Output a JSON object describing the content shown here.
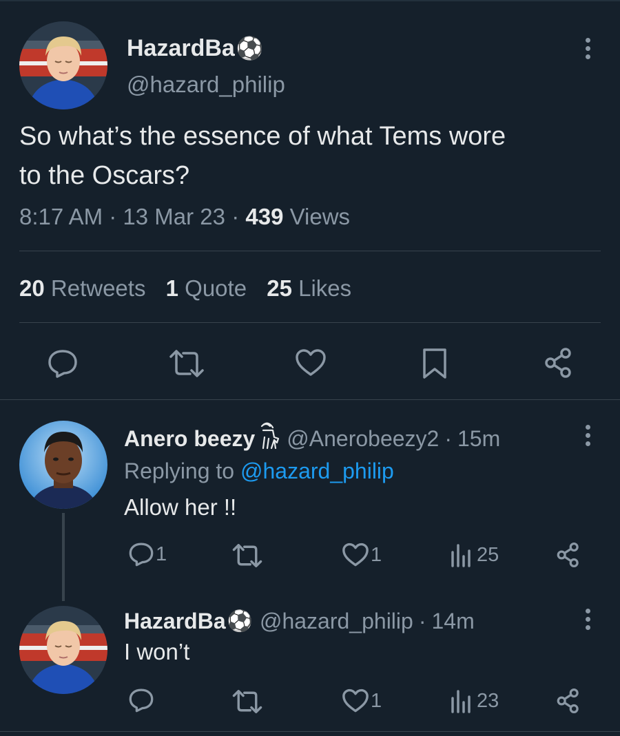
{
  "main_tweet": {
    "display_name": "HazardBa",
    "name_emoji": "⚽",
    "handle": "@hazard_philip",
    "text_line1": "So what’s the essence of what Tems wore",
    "text_line2": "to the Oscars?",
    "time": "8:17 AM",
    "date": "13 Mar 23",
    "views_count": "439",
    "views_label": "Views",
    "sep": "·",
    "retweets_count": "20",
    "retweets_label": "Retweets",
    "quotes_count": "1",
    "quotes_label": "Quote",
    "likes_count": "25",
    "likes_label": "Likes"
  },
  "reply1": {
    "display_name": "Anero beezy",
    "handle": "@Anerobeezy2",
    "sep": "·",
    "time": "15m",
    "replying_prefix": "Replying to",
    "replying_handle": "@hazard_philip",
    "text": "Allow her !!",
    "reply_count": "1",
    "like_count": "1",
    "view_count": "25"
  },
  "reply2": {
    "display_name": "HazardBa",
    "name_emoji": "⚽",
    "handle": "@hazard_philip",
    "sep": "·",
    "time": "14m",
    "text": "I won’t",
    "like_count": "1",
    "view_count": "23"
  },
  "colors": {
    "background": "#15202b",
    "text": "#e7e9ea",
    "muted": "#8b98a5",
    "link": "#1d9bf0",
    "divider": "#38444d"
  }
}
